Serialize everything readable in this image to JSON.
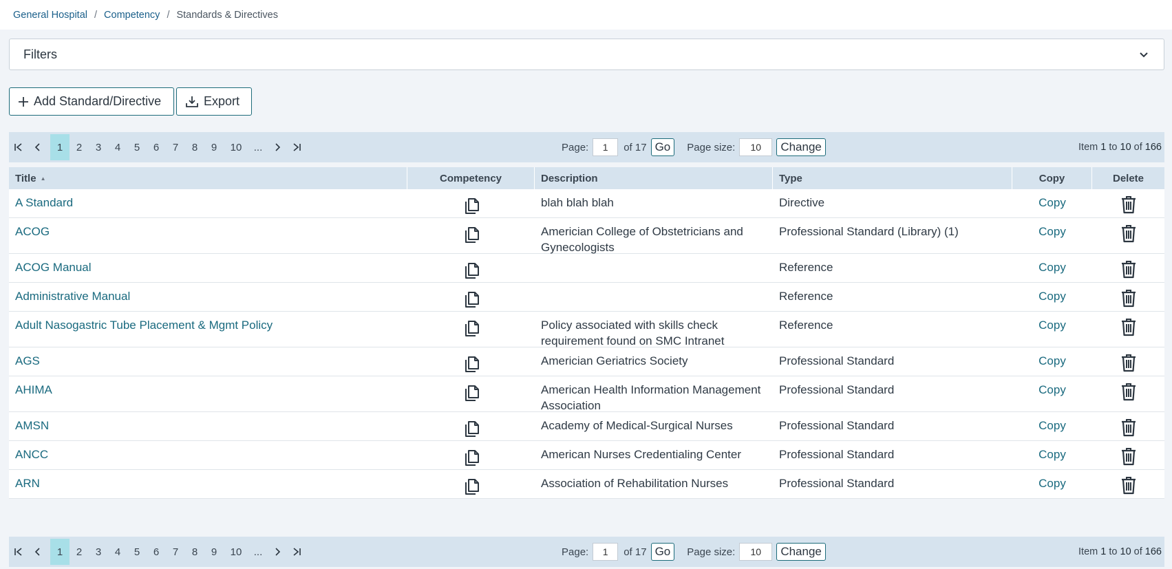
{
  "breadcrumb": {
    "items": [
      "General Hospital",
      "Competency"
    ],
    "current": "Standards & Directives"
  },
  "filters": {
    "label": "Filters"
  },
  "actions": {
    "add_label": "Add Standard/Directive",
    "export_label": "Export"
  },
  "pager": {
    "pages": [
      "1",
      "2",
      "3",
      "4",
      "5",
      "6",
      "7",
      "8",
      "9",
      "10",
      "..."
    ],
    "current_page": "1",
    "page_label": "Page:",
    "page_value": "1",
    "of_text": "of 17",
    "go_label": "Go",
    "size_label": "Page size:",
    "size_value": "10",
    "change_label": "Change",
    "info_prefix": "Item",
    "info_from": "1",
    "info_to_word": "to",
    "info_to": "10",
    "info_of_word": "of",
    "info_total": "166"
  },
  "table": {
    "headers": [
      "Title",
      "Competency",
      "Description",
      "Type",
      "Copy",
      "Delete"
    ],
    "rows": [
      {
        "title": "A Standard",
        "description": "blah blah blah",
        "type": "Directive",
        "copy": "Copy"
      },
      {
        "title": "ACOG",
        "description": "Americian College of Obstetricians and Gynecologists",
        "type": "Professional Standard (Library) (1)",
        "copy": "Copy"
      },
      {
        "title": "ACOG Manual",
        "description": "",
        "type": "Reference",
        "copy": "Copy"
      },
      {
        "title": "Administrative Manual",
        "description": "",
        "type": "Reference",
        "copy": "Copy"
      },
      {
        "title": "Adult Nasogastric Tube Placement & Mgmt Policy",
        "description": "Policy associated with skills check requirement found on SMC Intranet",
        "type": "Reference",
        "copy": "Copy"
      },
      {
        "title": "AGS",
        "description": "Americian Geriatrics Society",
        "type": "Professional Standard",
        "copy": "Copy"
      },
      {
        "title": "AHIMA",
        "description": "American Health Information Management Association",
        "type": "Professional Standard",
        "copy": "Copy"
      },
      {
        "title": "AMSN",
        "description": "Academy of Medical-Surgical Nurses",
        "type": "Professional Standard",
        "copy": "Copy"
      },
      {
        "title": "ANCC",
        "description": "American Nurses Credentialing Center",
        "type": "Professional Standard",
        "copy": "Copy"
      },
      {
        "title": "ARN",
        "description": "Association of Rehabilitation Nurses",
        "type": "Professional Standard",
        "copy": "Copy"
      }
    ]
  }
}
